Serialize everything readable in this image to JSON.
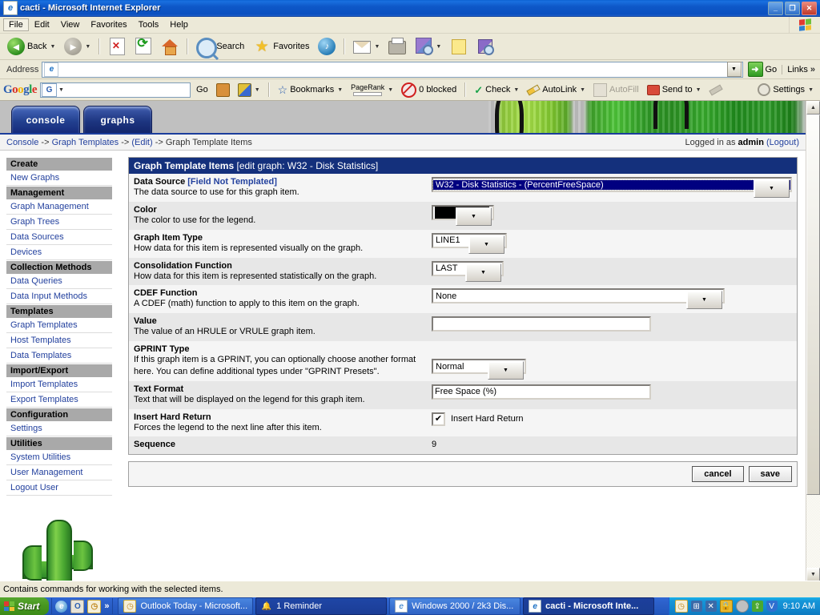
{
  "window": {
    "title": "cacti - Microsoft Internet Explorer",
    "icon": "ie-document-icon",
    "minimize": "_",
    "maximize": "❐",
    "close": "✕"
  },
  "menubar": {
    "items": [
      "File",
      "Edit",
      "View",
      "Favorites",
      "Tools",
      "Help"
    ]
  },
  "toolbar": {
    "back": "Back",
    "search": "Search",
    "favorites": "Favorites",
    "dropdown_caret": "▼"
  },
  "address": {
    "label": "Address",
    "value": "",
    "placeholder": "",
    "go": "Go",
    "links": "Links",
    "links_chevron": "»"
  },
  "google_toolbar": {
    "logo": [
      "G",
      "o",
      "o",
      "g",
      "l",
      "e"
    ],
    "select_letter": "G",
    "search_value": "",
    "go": "Go",
    "bookmarks": "Bookmarks",
    "pagerank": "PageRank",
    "blocked": "0 blocked",
    "check": "Check",
    "autolink": "AutoLink",
    "autofill": "AutoFill",
    "sendto": "Send to",
    "settings": "Settings",
    "caret": "▼"
  },
  "cacti": {
    "tabs": [
      {
        "label": "console",
        "active": true
      },
      {
        "label": "graphs",
        "active": false
      }
    ],
    "breadcrumb": {
      "items": [
        "Console",
        "Graph Templates",
        "(Edit)"
      ],
      "separator": "->",
      "current": "Graph Template Items"
    },
    "login_status": {
      "prefix": "Logged in as",
      "user": "admin",
      "logout": "(Logout)"
    },
    "sidebar": [
      {
        "type": "header",
        "label": "Create"
      },
      {
        "type": "link",
        "label": "New Graphs"
      },
      {
        "type": "header",
        "label": "Management"
      },
      {
        "type": "link",
        "label": "Graph Management"
      },
      {
        "type": "link",
        "label": "Graph Trees"
      },
      {
        "type": "link",
        "label": "Data Sources"
      },
      {
        "type": "link",
        "label": "Devices"
      },
      {
        "type": "header",
        "label": "Collection Methods"
      },
      {
        "type": "link",
        "label": "Data Queries"
      },
      {
        "type": "link",
        "label": "Data Input Methods"
      },
      {
        "type": "header",
        "label": "Templates"
      },
      {
        "type": "link",
        "label": "Graph Templates"
      },
      {
        "type": "link",
        "label": "Host Templates"
      },
      {
        "type": "link",
        "label": "Data Templates"
      },
      {
        "type": "header",
        "label": "Import/Export"
      },
      {
        "type": "link",
        "label": "Import Templates"
      },
      {
        "type": "link",
        "label": "Export Templates"
      },
      {
        "type": "header",
        "label": "Configuration"
      },
      {
        "type": "link",
        "label": "Settings"
      },
      {
        "type": "header",
        "label": "Utilities"
      },
      {
        "type": "link",
        "label": "System Utilities"
      },
      {
        "type": "link",
        "label": "User Management"
      },
      {
        "type": "link",
        "label": "Logout User"
      }
    ],
    "panel": {
      "title": "Graph Template Items",
      "subtitle": "[edit graph: W32 - Disk Statistics]",
      "rows": [
        {
          "label": "Data Source",
          "label_note": "[Field Not Templated]",
          "desc": "The data source to use for this graph item.",
          "control": "select-wide-focused",
          "value": "W32 - Disk Statistics - (PercentFreeSpace)"
        },
        {
          "label": "Color",
          "desc": "The color to use for the legend.",
          "control": "color-select",
          "value": "#000000"
        },
        {
          "label": "Graph Item Type",
          "desc": "How data for this item is represented visually on the graph.",
          "control": "select",
          "value": "LINE1"
        },
        {
          "label": "Consolidation Function",
          "desc": "How data for this item is represented statistically on the graph.",
          "control": "select",
          "value": "LAST"
        },
        {
          "label": "CDEF Function",
          "desc": "A CDEF (math) function to apply to this item on the graph.",
          "control": "select-medium",
          "value": "None"
        },
        {
          "label": "Value",
          "desc": "The value of an HRULE or VRULE graph item.",
          "control": "text",
          "value": ""
        },
        {
          "label": "GPRINT Type",
          "desc": "If this graph item is a GPRINT, you can optionally choose another format here. You can define additional types under \"GPRINT Presets\".",
          "control": "select",
          "value": "Normal"
        },
        {
          "label": "Text Format",
          "desc": "Text that will be displayed on the legend for this graph item.",
          "control": "text",
          "value": "Free Space (%)"
        },
        {
          "label": "Insert Hard Return",
          "desc": "Forces the legend to the next line after this item.",
          "control": "checkbox",
          "checked": true,
          "checkbox_label": "Insert Hard Return",
          "check_glyph": "✔"
        },
        {
          "label": "Sequence",
          "desc": "",
          "control": "static",
          "value": "9"
        }
      ],
      "buttons": {
        "cancel": "cancel",
        "save": "save"
      }
    }
  },
  "statusbar": {
    "text": "Contains commands for working with the selected items."
  },
  "taskbar": {
    "start": "Start",
    "quick_more": "»",
    "tasks": [
      {
        "label": "Outlook Today - Microsoft...",
        "state": "normal",
        "icon": "clock-icon"
      },
      {
        "label": "1 Reminder",
        "state": "reminder",
        "icon": "bell-icon"
      },
      {
        "label": "Windows 2000 / 2k3 Dis...",
        "state": "normal",
        "icon": "ie-icon"
      },
      {
        "label": "cacti - Microsoft Inte...",
        "state": "active",
        "icon": "ie-icon"
      }
    ],
    "clock": "9:10 AM"
  },
  "scrollbar": {
    "up": "▲",
    "down": "▼"
  }
}
